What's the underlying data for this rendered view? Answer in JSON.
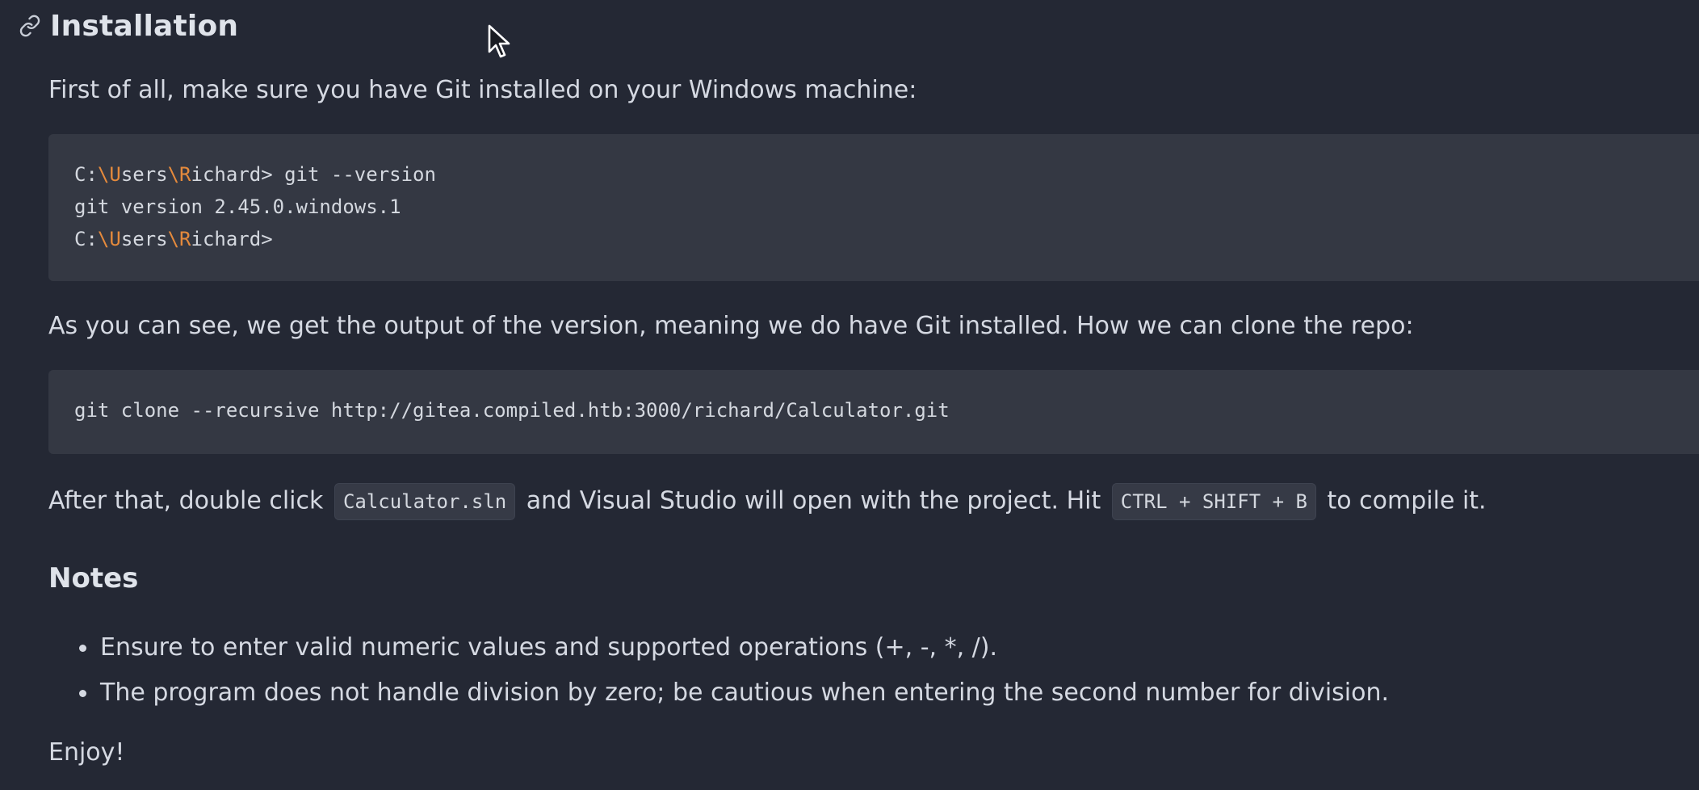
{
  "installation": {
    "title": "Installation",
    "intro": "First of all, make sure you have Git installed on your Windows machine:",
    "code1": {
      "line1": {
        "p1": "C:",
        "p2": "\\U",
        "p3": "sers",
        "p4": "\\R",
        "p5": "ichard> git --version"
      },
      "line2": "git version 2.45.0.windows.1",
      "line3": {
        "p1": "C:",
        "p2": "\\U",
        "p3": "sers",
        "p4": "\\R",
        "p5": "ichard>"
      }
    },
    "after_version": "As you can see, we get the output of the version, meaning we do have Git installed. How we can clone the repo:",
    "code2": "git clone --recursive http://gitea.compiled.htb:3000/richard/Calculator.git",
    "after_clone": {
      "t1": "After that, double click",
      "c1": "Calculator.sln",
      "t2": "and Visual Studio will open with the project. Hit",
      "c2": "CTRL + SHIFT + B",
      "t3": "to compile it."
    }
  },
  "notes": {
    "title": "Notes",
    "items": [
      "Ensure to enter valid numeric values and supported operations (+, -, *, /).",
      "The program does not handle division by zero; be cautious when entering the second number for division."
    ]
  },
  "closing": "Enjoy!",
  "colors": {
    "background": "#242834",
    "code_background": "#343843",
    "highlight": "#e58a3c"
  },
  "icons": [
    "link-icon",
    "mouse-cursor-icon"
  ]
}
